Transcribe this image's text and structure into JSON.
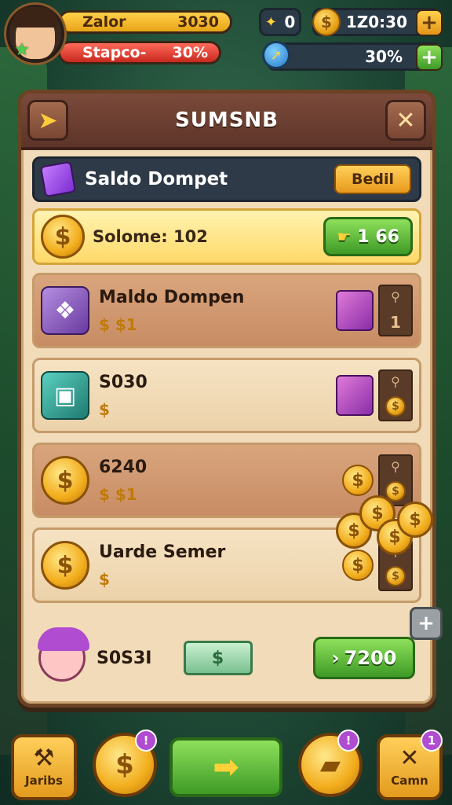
{
  "hud": {
    "bar1_label": "Zalor",
    "bar1_value": "3030",
    "bar2_label": "Stapco-",
    "bar2_value": "30%",
    "star_count": "0",
    "coins": "1Z0:30",
    "percent": "30%"
  },
  "panel": {
    "title": "SUMSNB",
    "wallet": {
      "title": "Saldo Dompet",
      "button": "Bedil"
    },
    "balance": {
      "text": "Solome: 102",
      "button": "1 66"
    },
    "items": [
      {
        "name": "Maldo Dompen",
        "price": "$ $1",
        "slot": "1"
      },
      {
        "name": "S030",
        "price": "$"
      },
      {
        "name": "6240",
        "price": "$ $1"
      },
      {
        "name": "Uarde Semer",
        "price": "$"
      }
    ],
    "footer": {
      "name": "S0S3I",
      "cta": "7200"
    }
  },
  "nav": {
    "left_label": "Jaribs",
    "right_label": "Camn",
    "badge1": "!",
    "badge2": "!",
    "badge3": "1"
  },
  "icons": {
    "avatar": "player-portrait",
    "coin": "dollar-coin",
    "star": "star",
    "plus": "plus",
    "close": "x",
    "back": "arrow"
  },
  "colors": {
    "gold": "#e8a317",
    "green": "#3e9a26",
    "panel": "#f1dbb8",
    "header": "#5d3528"
  }
}
